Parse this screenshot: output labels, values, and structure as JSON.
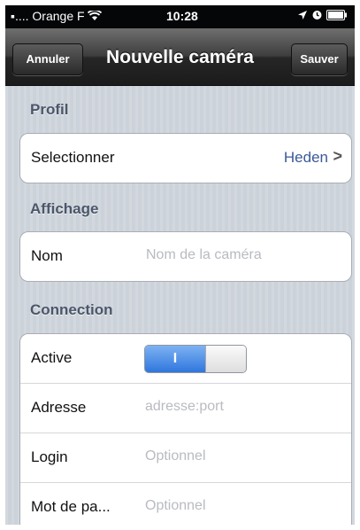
{
  "status_bar": {
    "carrier": "Orange F",
    "time": "10:28",
    "wifi_icon": "wifi-icon",
    "location_icon": "location-arrow-icon",
    "alarm_icon": "alarm-icon",
    "battery_icon": "battery-icon"
  },
  "nav": {
    "cancel_label": "Annuler",
    "title": "Nouvelle caméra",
    "save_label": "Sauver"
  },
  "sections": {
    "profil": {
      "header": "Profil",
      "select_label": "Selectionner",
      "select_value": "Heden",
      "chevron": ">"
    },
    "affichage": {
      "header": "Affichage",
      "name_label": "Nom",
      "name_placeholder": "Nom de la caméra"
    },
    "connection": {
      "header": "Connection",
      "active_label": "Active",
      "active_toggle_text": "I",
      "address_label": "Adresse",
      "address_placeholder": "adresse:port",
      "login_label": "Login",
      "login_placeholder": "Optionnel",
      "password_label": "Mot de pa...",
      "password_placeholder": "Optionnel"
    }
  },
  "colors": {
    "nav_bar": "#262626",
    "background": "#cbd2d9",
    "section_header": "#4c566a",
    "toggle_on": "#2f76dd",
    "detail_value": "#3b5998"
  }
}
